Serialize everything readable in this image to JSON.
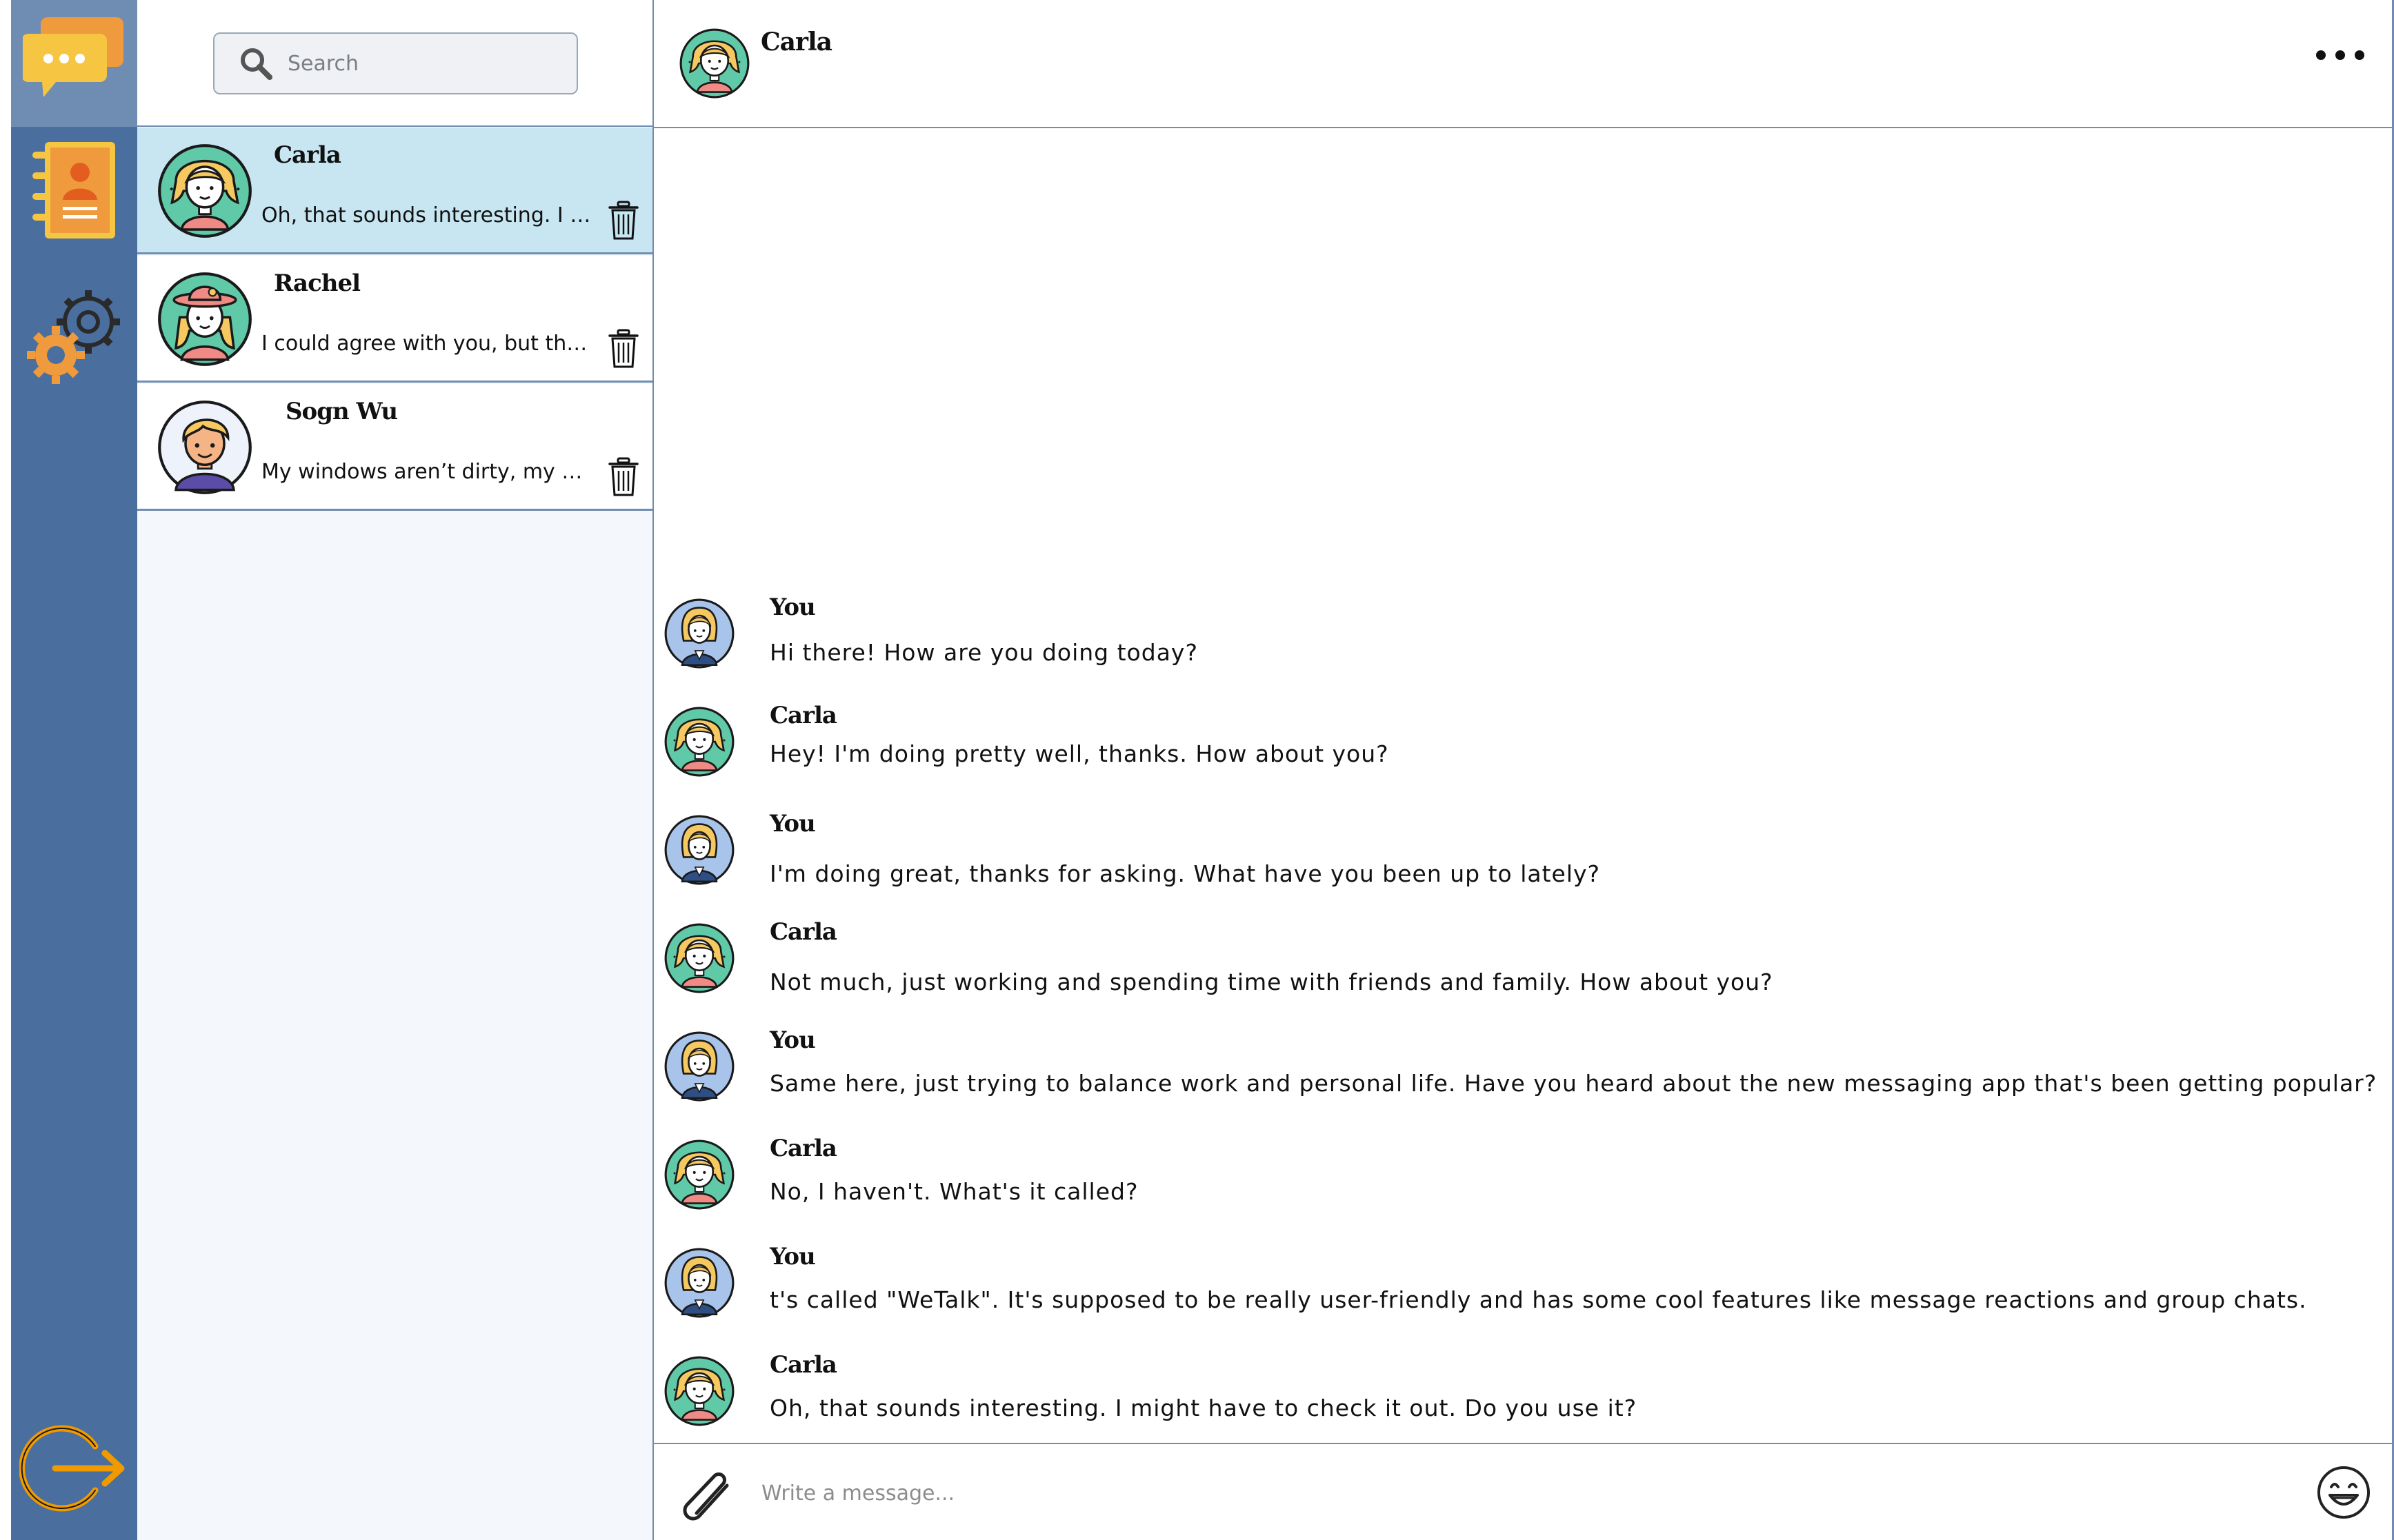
{
  "app": {
    "brand_color": "#4a6f9e",
    "active_row_color": "#c8e6f2"
  },
  "rail": {
    "items": [
      {
        "name": "chat-bubbles-icon"
      },
      {
        "name": "contacts-book-icon"
      },
      {
        "name": "settings-gears-icon"
      },
      {
        "name": "logout-icon"
      }
    ]
  },
  "search": {
    "placeholder": "Search"
  },
  "contacts": [
    {
      "name": "Carla",
      "preview": "Oh, that sounds interesting. I might have to check it out. Do you use it?",
      "avatar": "female-avatar-green",
      "active": true
    },
    {
      "name": "Rachel",
      "preview": "I could agree with you, but then we'd both be wrong.",
      "avatar": "female-avatar-hat"
    },
    {
      "name": "Sogn Wu",
      "preview": "My windows aren’t dirty, my dog is just painting them.",
      "avatar": "male-avatar-blond"
    }
  ],
  "chat": {
    "title": "Carla",
    "messages": [
      {
        "who": "You",
        "text": "Hi there! How are you doing today?"
      },
      {
        "who": "Carla",
        "text": "Hey! I'm doing pretty well, thanks. How about you?"
      },
      {
        "who": "You",
        "text": "I'm doing great, thanks for asking. What have you been up to lately?"
      },
      {
        "who": "Carla",
        "text": "Not much, just working and spending time with friends and family. How about you?"
      },
      {
        "who": "You",
        "text": "Same here, just trying to balance work and personal life. Have you heard about the new messaging app that's been getting popular?"
      },
      {
        "who": "Carla",
        "text": "No, I haven't. What's it called?"
      },
      {
        "who": "You",
        "text": "t's called \"WeTalk\". It's supposed to be really user-friendly and has some cool features like message reactions and group chats."
      },
      {
        "who": "Carla",
        "text": "Oh, that sounds interesting. I might have to check it out. Do you use it?"
      }
    ],
    "composer_placeholder": "Write a message..."
  }
}
